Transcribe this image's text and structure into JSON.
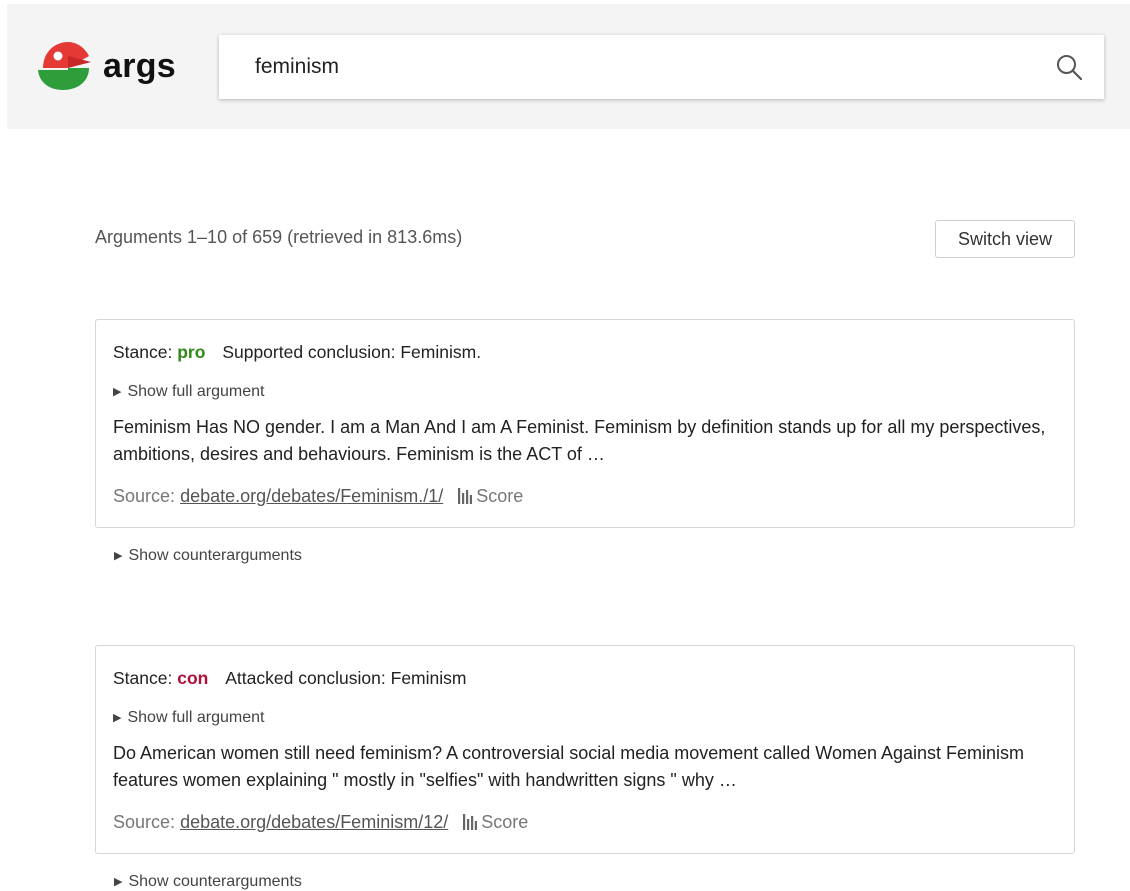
{
  "header": {
    "logo_text": "args",
    "search": {
      "value": "feminism",
      "placeholder": ""
    }
  },
  "results": {
    "summary": "Arguments 1–10 of 659 (retrieved in 813.6ms)",
    "switch_view_label": "Switch view"
  },
  "arguments": [
    {
      "stance_label": "Stance:",
      "stance": "pro",
      "conclusion_label": "Supported conclusion:",
      "conclusion": "Feminism.",
      "show_full_label": "Show full argument",
      "text": "Feminism Has NO gender. I am a Man And I am A Feminist. Feminism by definition stands up for all my perspectives, ambitions, desires and behaviours. Feminism is the ACT of …",
      "source_label": "Source:",
      "source": "debate.org/debates/Feminism./1/",
      "score_label": "Score",
      "counter_label": "Show counterarguments"
    },
    {
      "stance_label": "Stance:",
      "stance": "con",
      "conclusion_label": "Attacked conclusion:",
      "conclusion": "Feminism",
      "show_full_label": "Show full argument",
      "text": "Do American women still need feminism? A controversial social media movement called Women Against Feminism features women explaining \" mostly in \"selfies\" with handwritten signs \" why …",
      "source_label": "Source:",
      "source": "debate.org/debates/Feminism/12/",
      "score_label": "Score",
      "counter_label": "Show counterarguments"
    }
  ],
  "colors": {
    "pro": "#2e8b17",
    "con": "#b0103a",
    "logo_red": "#e53935",
    "logo_green": "#2e9e3a",
    "header_bg": "#f4f4f4"
  },
  "icons": [
    "logo-parrot-icon",
    "search-icon",
    "triangle-right-icon",
    "score-bars-icon"
  ]
}
